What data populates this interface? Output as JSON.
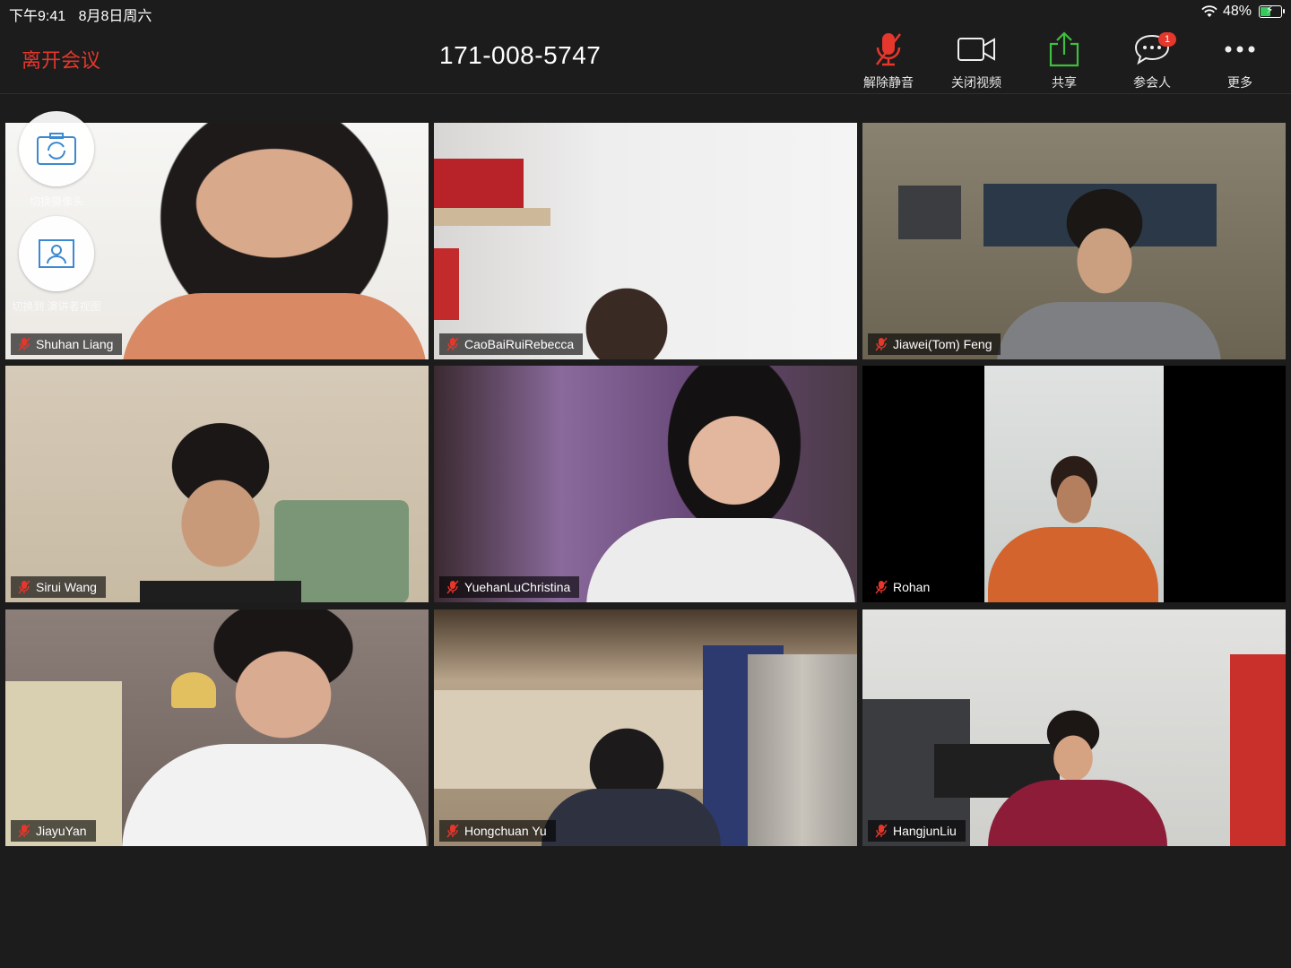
{
  "status_bar": {
    "time": "下午9:41",
    "date": "8月8日周六",
    "battery": "48%",
    "icons": [
      "wifi-icon",
      "battery-charging-icon"
    ]
  },
  "header": {
    "leave_label": "离开会议",
    "meeting_id": "171-008-5747",
    "toolbar": [
      {
        "label": "解除静音",
        "icon": "microphone-muted-icon"
      },
      {
        "label": "关闭视频",
        "icon": "video-camera-icon"
      },
      {
        "label": "共享",
        "icon": "share-upload-icon"
      },
      {
        "label": "参会人",
        "icon": "chat-bubble-icon",
        "badge": "1"
      },
      {
        "label": "更多",
        "icon": "more-dots-icon"
      }
    ]
  },
  "self_view_controls": [
    {
      "label": "切换摄像头",
      "icon": "switch-camera-icon"
    },
    {
      "label": "切换到 演讲者视图",
      "icon": "speaker-view-icon"
    }
  ],
  "participants": [
    {
      "name": "Shuhan Liang",
      "muted": true
    },
    {
      "name": "CaoBaiRuiRebecca",
      "muted": true
    },
    {
      "name": "Jiawei(Tom) Feng",
      "muted": true
    },
    {
      "name": "Sirui Wang",
      "muted": true
    },
    {
      "name": "YuehanLuChristina",
      "muted": true
    },
    {
      "name": "Rohan",
      "muted": true
    },
    {
      "name": "JiayuYan",
      "muted": true
    },
    {
      "name": "Hongchuan Yu",
      "muted": true
    },
    {
      "name": "HangjunLiu",
      "muted": true
    }
  ],
  "colors": {
    "background": "#1c1c1c",
    "leave": "#e5372c",
    "share_green": "#3fbf3f",
    "mute_red": "#e5372c"
  }
}
